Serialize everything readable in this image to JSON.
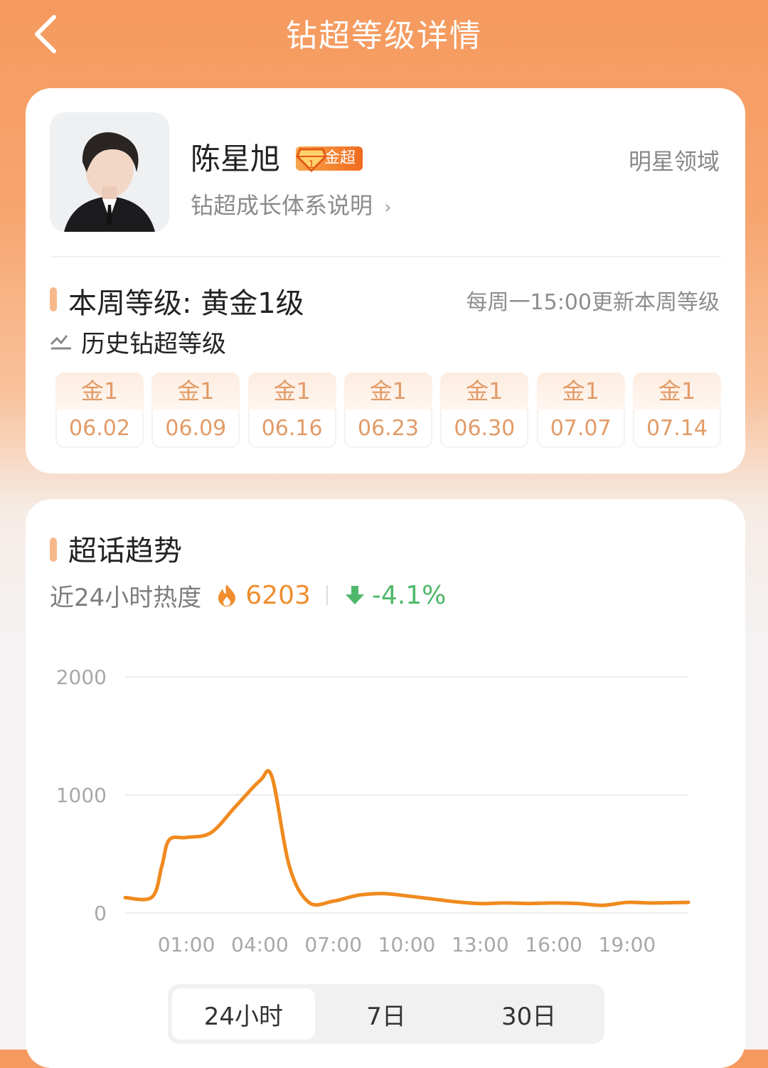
{
  "header": {
    "title": "钻超等级详情"
  },
  "profile": {
    "name": "陈星旭",
    "badge": "金超",
    "growth_link": "钻超成长体系说明",
    "domain": "明星领域"
  },
  "level": {
    "current": "本周等级: 黄金1级",
    "update_note": "每周一15:00更新本周等级",
    "history_title": "历史钻超等级",
    "history": [
      {
        "level": "金1",
        "date": "06.02"
      },
      {
        "level": "金1",
        "date": "06.09"
      },
      {
        "level": "金1",
        "date": "06.16"
      },
      {
        "level": "金1",
        "date": "06.23"
      },
      {
        "level": "金1",
        "date": "06.30"
      },
      {
        "level": "金1",
        "date": "07.07"
      },
      {
        "level": "金1",
        "date": "07.14"
      }
    ]
  },
  "trend": {
    "title": "超话趋势",
    "heat_label": "近24小时热度",
    "heat_value": "6203",
    "heat_change": "-4.1%",
    "colors": {
      "line": "#f08a1e",
      "up": "#f08d2f",
      "down": "#4fb86a"
    }
  },
  "chart_data": {
    "type": "line",
    "x_ticks": [
      "01:00",
      "04:00",
      "07:00",
      "10:00",
      "13:00",
      "16:00",
      "19:00"
    ],
    "y_ticks": [
      "2000",
      "1000",
      "0"
    ],
    "ylim": [
      0,
      2000
    ],
    "x_hours_start": -1.5,
    "x_hours_end": 21.5,
    "series": [
      {
        "x": [
          -1.5,
          -0.4,
          0,
          0.3,
          1,
          2,
          3,
          4,
          4.5,
          5.2,
          6,
          7,
          8,
          9,
          10,
          11,
          12,
          13,
          14,
          15,
          16,
          17,
          18,
          19,
          20,
          21.5
        ],
        "values": [
          130,
          135,
          400,
          620,
          640,
          680,
          900,
          1120,
          1150,
          400,
          90,
          100,
          150,
          165,
          145,
          120,
          95,
          80,
          85,
          80,
          85,
          80,
          65,
          90,
          85,
          90
        ]
      }
    ]
  },
  "range_tabs": [
    "24小时",
    "7日",
    "30日"
  ],
  "active_tab": "24小时"
}
